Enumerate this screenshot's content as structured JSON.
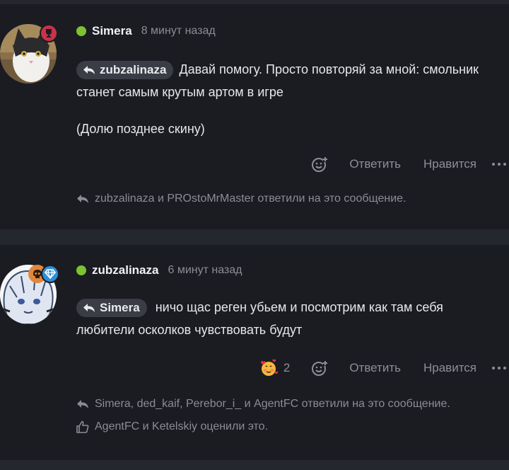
{
  "posts": [
    {
      "author": "Simera",
      "time": "8 минут назад",
      "reply_to": "zubzalinaza",
      "text_lines": [
        "Давай помогу. Просто повторяй за мной: смольник",
        "станет самым крутым артом в игре"
      ],
      "paragraph2": "(Долю позднее скину)",
      "reply_label": "Ответить",
      "like_label": "Нравится",
      "replies_note": "zubzalinaza и PROstoMrMaster ответили на это сообщение."
    },
    {
      "author": "zubzalinaza",
      "time": "6 минут назад",
      "reply_to": "Simera",
      "text_lines": [
        "ничо щас реген убьем и посмотрим как там себя",
        "любители осколков чувствовать будут"
      ],
      "reaction_count": "2",
      "reply_label": "Ответить",
      "like_label": "Нравится",
      "replies_note": "Simera, ded_kaif, Perebor_i_ и AgentFC ответили на это сообщение.",
      "likes_note": "AgentFC и Ketelskiy оценили это."
    }
  ],
  "colors": {
    "background": "#25272e",
    "card": "#1b1c22",
    "online": "#7dc232",
    "trophy_badge": "#c8324a",
    "skull_badge": "#e2873a",
    "diamond_badge": "#2f8fd8"
  },
  "icons": [
    "trophy-icon",
    "skull-icon",
    "diamond-icon",
    "reply-arrow-icon",
    "add-reaction-icon",
    "more-icon",
    "heart-face-emoji",
    "thumbs-up-icon"
  ]
}
